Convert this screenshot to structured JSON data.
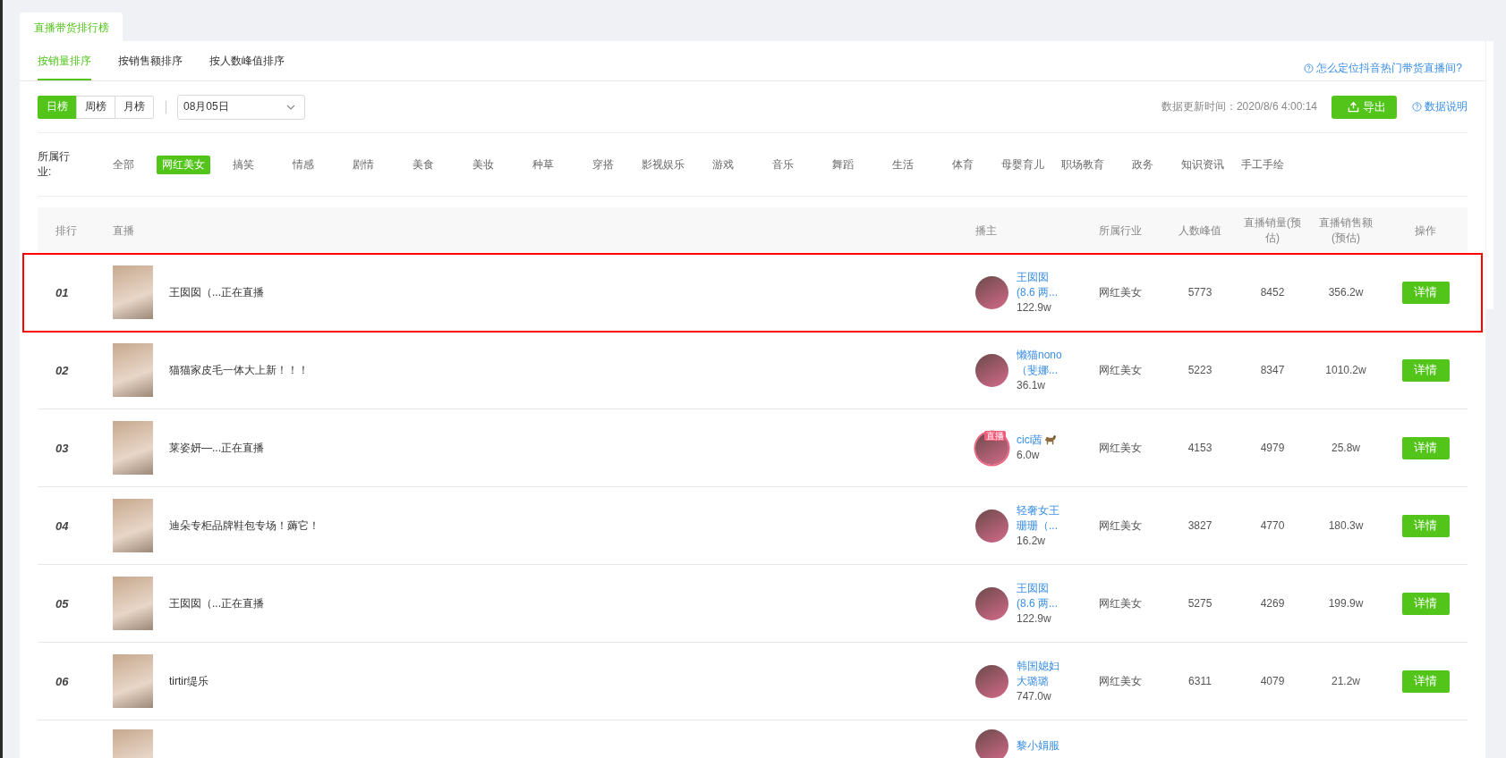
{
  "page_tab": {
    "label": "直播带货排行榜",
    "selected": true
  },
  "sort_tabs": [
    {
      "label": "按销量排序",
      "selected": true
    },
    {
      "label": "按销售额排序",
      "selected": false
    },
    {
      "label": "按人数峰值排序",
      "selected": false
    }
  ],
  "help_link": "怎么定位抖音热门带货直播间?",
  "periods": [
    {
      "label": "日榜",
      "selected": true
    },
    {
      "label": "周榜",
      "selected": false
    },
    {
      "label": "月榜",
      "selected": false
    }
  ],
  "date_select": {
    "value": "08月05日"
  },
  "update_time": "数据更新时间：2020/8/6 4:00:14",
  "export_button": "导出",
  "data_note_link": "数据说明",
  "industry_label": "所属行业:",
  "industries": [
    {
      "label": "全部",
      "selected": false
    },
    {
      "label": "网红美女",
      "selected": true
    },
    {
      "label": "搞笑",
      "selected": false
    },
    {
      "label": "情感",
      "selected": false
    },
    {
      "label": "剧情",
      "selected": false
    },
    {
      "label": "美食",
      "selected": false
    },
    {
      "label": "美妆",
      "selected": false
    },
    {
      "label": "种草",
      "selected": false
    },
    {
      "label": "穿搭",
      "selected": false
    },
    {
      "label": "影视娱乐",
      "selected": false
    },
    {
      "label": "游戏",
      "selected": false
    },
    {
      "label": "音乐",
      "selected": false
    },
    {
      "label": "舞蹈",
      "selected": false
    },
    {
      "label": "生活",
      "selected": false
    },
    {
      "label": "体育",
      "selected": false
    },
    {
      "label": "母婴育儿",
      "selected": false
    },
    {
      "label": "职场教育",
      "selected": false
    },
    {
      "label": "政务",
      "selected": false
    },
    {
      "label": "知识资讯",
      "selected": false
    },
    {
      "label": "手工手绘",
      "selected": false
    }
  ],
  "table": {
    "columns": [
      "排行",
      "直播",
      "播主",
      "所属行业",
      "人数峰值",
      "直播销量(预估)",
      "直播销售额(预估)",
      "操作"
    ],
    "rows": [
      {
        "rank": "01",
        "title": "王囡囡（...正在直播",
        "anchor": [
          "王囡囡",
          "(8.6 两..."
        ],
        "fans": "122.9w",
        "industry": "网红美女",
        "peak": "5773",
        "sales": "8452",
        "revenue": "356.2w",
        "action": "详情",
        "highlighted": true,
        "live_badge": ""
      },
      {
        "rank": "02",
        "title": "猫猫家皮毛一体大上新！！！",
        "anchor": [
          "懒猫nono",
          "（斐娜..."
        ],
        "fans": "36.1w",
        "industry": "网红美女",
        "peak": "5223",
        "sales": "8347",
        "revenue": "1010.2w",
        "action": "详情",
        "highlighted": false,
        "live_badge": ""
      },
      {
        "rank": "03",
        "title": "莱姿妍—...正在直播",
        "anchor": [
          "cici茜"
        ],
        "fans": "6.0w",
        "industry": "网红美女",
        "peak": "4153",
        "sales": "4979",
        "revenue": "25.8w",
        "action": "详情",
        "highlighted": false,
        "live_badge": "直播",
        "name_emoji": true
      },
      {
        "rank": "04",
        "title": "迪朵专柜品牌鞋包专场！薅它！",
        "anchor": [
          "轻奢女王",
          "珊珊（..."
        ],
        "fans": "16.2w",
        "industry": "网红美女",
        "peak": "3827",
        "sales": "4770",
        "revenue": "180.3w",
        "action": "详情",
        "highlighted": false,
        "live_badge": ""
      },
      {
        "rank": "05",
        "title": "王囡囡（...正在直播",
        "anchor": [
          "王囡囡",
          "(8.6 两..."
        ],
        "fans": "122.9w",
        "industry": "网红美女",
        "peak": "5275",
        "sales": "4269",
        "revenue": "199.9w",
        "action": "详情",
        "highlighted": false,
        "live_badge": ""
      },
      {
        "rank": "06",
        "title": "tirtir缇乐",
        "anchor": [
          "韩国媳妇",
          "大璐璐"
        ],
        "fans": "747.0w",
        "industry": "网红美女",
        "peak": "6311",
        "sales": "4079",
        "revenue": "21.2w",
        "action": "详情",
        "highlighted": false,
        "live_badge": ""
      },
      {
        "anchor": [
          "黎小娟服"
        ],
        "highlighted": false
      }
    ]
  }
}
